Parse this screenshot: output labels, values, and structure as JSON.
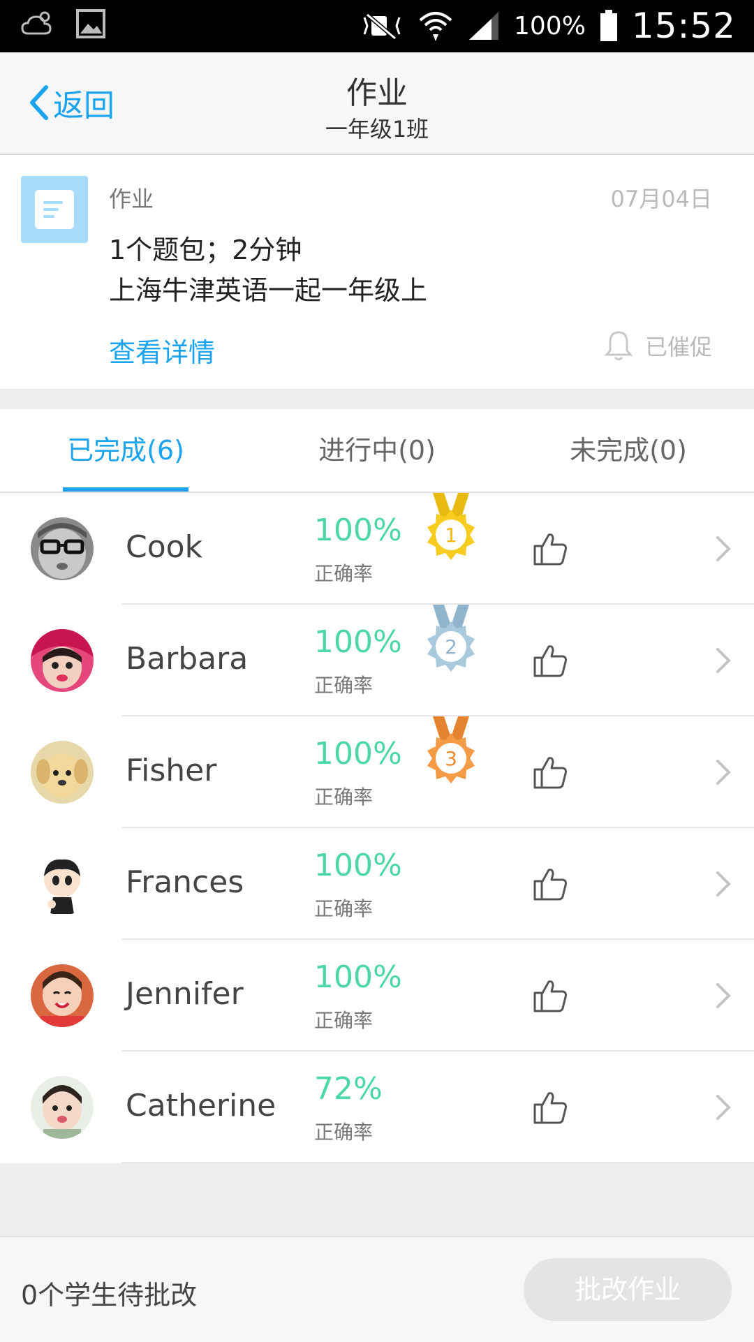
{
  "status_bar": {
    "battery": "100%",
    "time": "15:52",
    "icons": [
      "weather-icon",
      "image-icon",
      "mute-icon",
      "wifi-icon",
      "signal-icon",
      "battery-icon"
    ]
  },
  "nav": {
    "back_label": "返回",
    "title": "作业",
    "subtitle": "一年级1班"
  },
  "homework": {
    "type_label": "作业",
    "date": "07月04日",
    "summary": "1个题包；2分钟",
    "book": "上海牛津英语一起一年级上",
    "detail_link": "查看详情",
    "reminded_label": "已催促"
  },
  "tabs": [
    {
      "label": "已完成(6)",
      "active": true
    },
    {
      "label": "进行中(0)",
      "active": false
    },
    {
      "label": "未完成(0)",
      "active": false
    }
  ],
  "students": [
    {
      "name": "Cook",
      "score": "100%",
      "score_label": "正确率",
      "medal": "1",
      "avatar": "glasses-kid-avatar"
    },
    {
      "name": "Barbara",
      "score": "100%",
      "score_label": "正确率",
      "medal": "2",
      "avatar": "girl-red-hat-avatar"
    },
    {
      "name": "Fisher",
      "score": "100%",
      "score_label": "正确率",
      "medal": "3",
      "avatar": "puppy-avatar"
    },
    {
      "name": "Frances",
      "score": "100%",
      "score_label": "正确率",
      "medal": "",
      "avatar": "cartoon-boy-avatar"
    },
    {
      "name": "Jennifer",
      "score": "100%",
      "score_label": "正确率",
      "medal": "",
      "avatar": "smiling-girl-avatar"
    },
    {
      "name": "Catherine",
      "score": "72%",
      "score_label": "正确率",
      "medal": "",
      "avatar": "toddler-avatar"
    }
  ],
  "colors": {
    "accent": "#1aa3ef",
    "score": "#4cd8a2",
    "gold": "#f7cc1e",
    "silver": "#a9c9dc",
    "bronze": "#f59a45"
  },
  "bottom": {
    "pending": "0个学生待批改",
    "grade_button": "批改作业"
  }
}
